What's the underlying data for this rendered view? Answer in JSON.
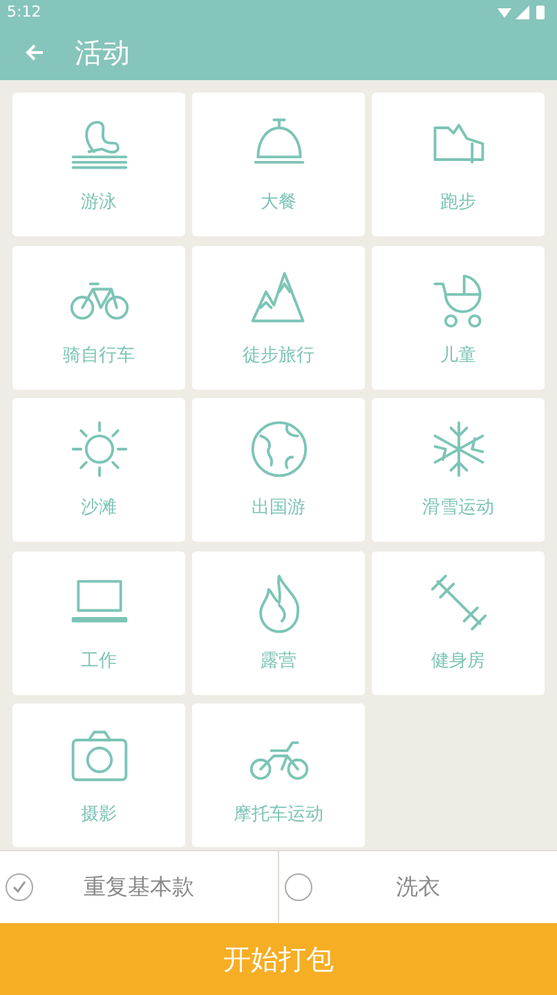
{
  "status_bar": {
    "time": "5:12"
  },
  "header": {
    "title": "活动"
  },
  "activities": [
    {
      "label": "游泳"
    },
    {
      "label": "大餐"
    },
    {
      "label": "跑步"
    },
    {
      "label": "骑自行车"
    },
    {
      "label": "徒步旅行"
    },
    {
      "label": "儿童"
    },
    {
      "label": "沙滩"
    },
    {
      "label": "出国游"
    },
    {
      "label": "滑雪运动"
    },
    {
      "label": "工作"
    },
    {
      "label": "露营"
    },
    {
      "label": "健身房"
    },
    {
      "label": "摄影"
    },
    {
      "label": "摩托车运动"
    }
  ],
  "options": [
    {
      "label": "重复基本款",
      "checked": true
    },
    {
      "label": "洗衣",
      "checked": false
    }
  ],
  "start_button": {
    "label": "开始打包"
  }
}
